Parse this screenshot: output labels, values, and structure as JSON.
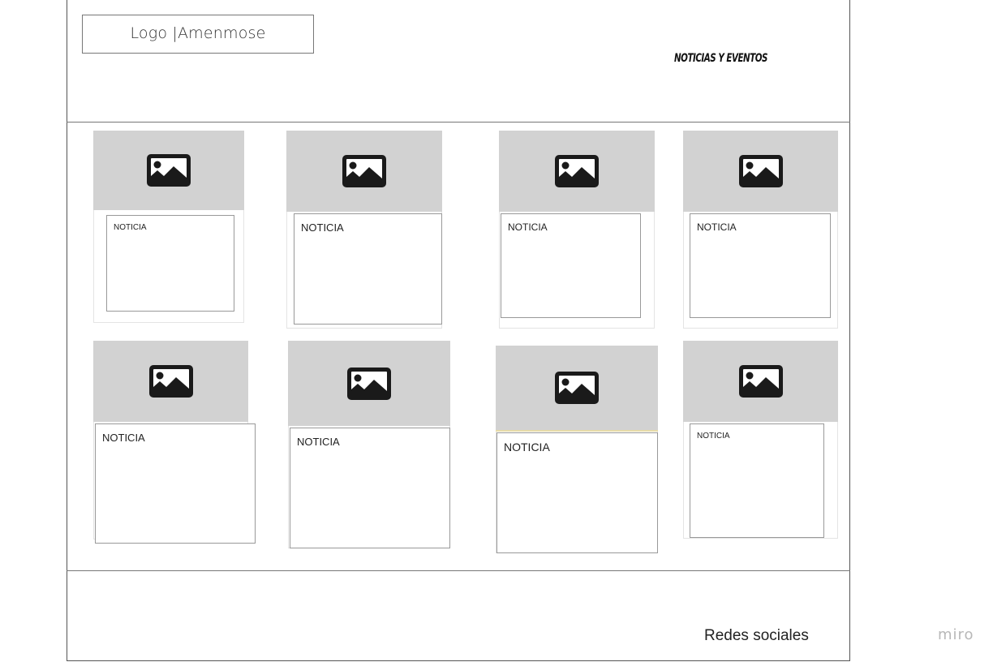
{
  "header": {
    "logo_text": "Logo |Amenmose",
    "nav_title": "NOTICIAS Y EVENTOS"
  },
  "cards": [
    {
      "label": "NOTICIA",
      "icon": "image-icon"
    },
    {
      "label": "NOTICIA",
      "icon": "image-icon"
    },
    {
      "label": "NOTICIA",
      "icon": "image-icon"
    },
    {
      "label": "NOTICIA",
      "icon": "image-icon"
    },
    {
      "label": "NOTICIA",
      "icon": "image-icon"
    },
    {
      "label": "NOTICIA",
      "icon": "image-icon"
    },
    {
      "label": "NOTICIA",
      "icon": "image-icon"
    },
    {
      "label": "NOTICIA",
      "icon": "image-icon"
    }
  ],
  "footer": {
    "social_text": "Redes sociales"
  },
  "watermark": "miro",
  "colors": {
    "image_placeholder": "#d2d2d2",
    "border": "#999999",
    "icon": "#1a1a1a"
  }
}
